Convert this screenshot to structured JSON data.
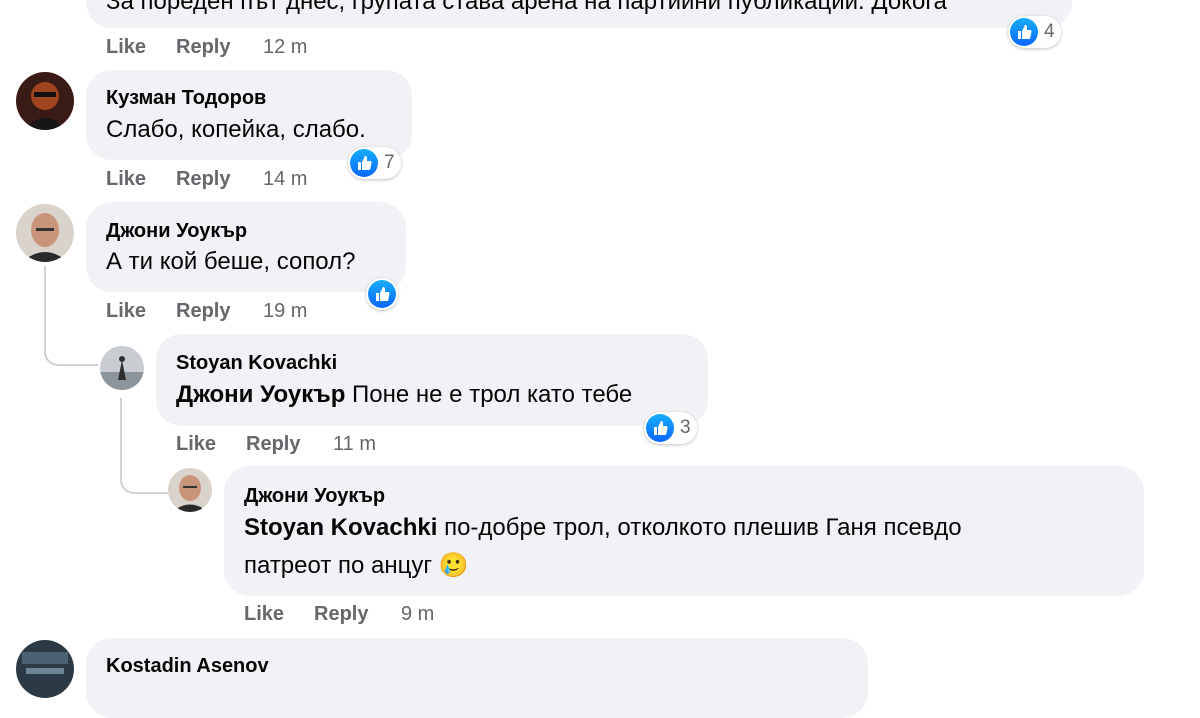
{
  "labels": {
    "like": "Like",
    "reply": "Reply"
  },
  "comments": [
    {
      "text": "За пореден път днес, групата става арена на партийни публикации. Докога",
      "time": "12 m",
      "reactions": "4"
    },
    {
      "author": "Кузман Тодоров",
      "text": "Слабо, копейка, слабо.",
      "time": "14 m",
      "reactions": "7"
    },
    {
      "author": "Джони Уоукър",
      "text": "А ти кой беше, сопол?",
      "time": "19 m",
      "reactions": ""
    },
    {
      "author": "Stoyan Kovachki",
      "mention": "Джони Уоукър",
      "text": "Поне не е трол като тебе",
      "time": "11 m",
      "reactions": "3"
    },
    {
      "author": "Джони Уоукър",
      "mention": "Stoyan Kovachki",
      "text": "по-добре трол, отколкото плешив Ганя псевдо",
      "text2": "патреот по анцуг",
      "emoji": "🥲",
      "time": "9 m"
    },
    {
      "author": "Kostadin Asenov"
    }
  ],
  "icons": {
    "reaction": "like-icon",
    "emoji": "smiling-face-with-tear"
  },
  "colors": {
    "like_blue": "#0866ff",
    "bubble": "#f0f2f5",
    "meta_gray": "#65676b"
  }
}
